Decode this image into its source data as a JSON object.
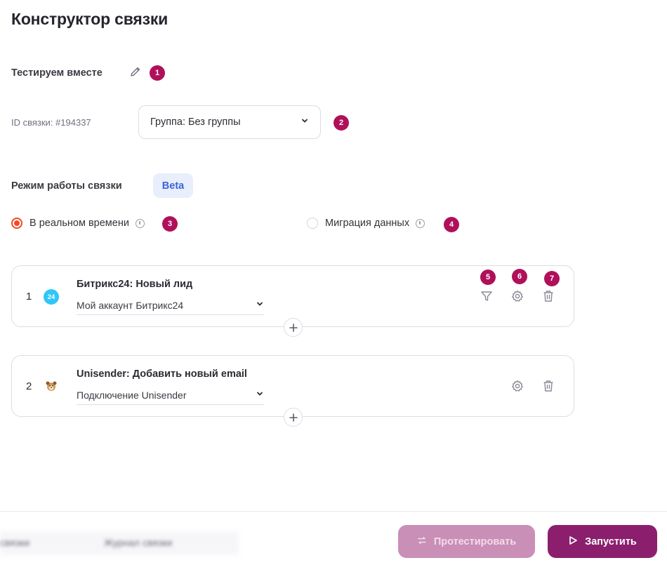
{
  "page": {
    "title": "Конструктор связки"
  },
  "bundle": {
    "name": "Тестируем вместе",
    "id_label": "ID связки: #194337",
    "group_select": "Группа: Без группы"
  },
  "mode": {
    "label": "Режим работы связки",
    "beta": "Beta",
    "options": [
      {
        "label": "В реальном времени",
        "selected": true
      },
      {
        "label": "Миграция данных",
        "selected": false
      }
    ]
  },
  "badges": [
    "1",
    "2",
    "3",
    "4",
    "5",
    "6",
    "7"
  ],
  "steps": [
    {
      "number": "1",
      "title": "Битрикс24: Новый лид",
      "account": "Мой аккаунт Битрикс24",
      "logo_text": "24",
      "icon": "bitrix24-logo"
    },
    {
      "number": "2",
      "title": "Unisender: Добавить новый email",
      "account": "Подключение Unisender",
      "icon": "unisender-logo"
    }
  ],
  "footer": {
    "tabs": [
      "связки",
      "Журнал связки"
    ],
    "test_button": "Протестировать",
    "run_button": "Запустить"
  },
  "colors": {
    "accent": "#8b1f6e",
    "badge": "#b0105a",
    "radio_active": "#f04a26",
    "beta_bg": "#e8eefc",
    "beta_text": "#3c64d6",
    "bitrix": "#2fc7f7"
  }
}
